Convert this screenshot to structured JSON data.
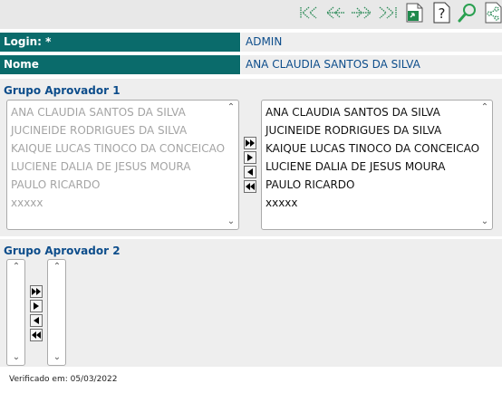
{
  "toolbar": {
    "buttons": [
      {
        "name": "first-record-icon"
      },
      {
        "name": "previous-record-icon"
      },
      {
        "name": "next-record-icon"
      },
      {
        "name": "last-record-icon"
      },
      {
        "name": "export-document-icon"
      },
      {
        "name": "help-icon"
      },
      {
        "name": "search-icon"
      },
      {
        "name": "share-icon"
      }
    ]
  },
  "form": {
    "login_label": "Login: *",
    "login_value": "ADMIN",
    "nome_label": "Nome",
    "nome_value": "ANA CLAUDIA SANTOS DA SILVA"
  },
  "grupo1": {
    "title": "Grupo Aprovador 1",
    "available": [
      "ANA CLAUDIA SANTOS DA SILVA",
      "JUCINEIDE RODRIGUES DA SILVA",
      "KAIQUE LUCAS TINOCO DA CONCEICAO",
      "LUCIENE DALIA DE JESUS MOURA",
      "PAULO RICARDO",
      "xxxxx"
    ],
    "selected": [
      "ANA CLAUDIA SANTOS DA SILVA",
      "JUCINEIDE RODRIGUES DA SILVA",
      "KAIQUE LUCAS TINOCO DA CONCEICAO",
      "LUCIENE DALIA DE JESUS MOURA",
      "PAULO RICARDO",
      "xxxxx"
    ]
  },
  "grupo2": {
    "title": "Grupo Aprovador 2",
    "available": [],
    "selected": []
  },
  "footer": {
    "verified": "Verificado em: 05/03/2022"
  },
  "colors": {
    "label_bg": "#0a6b6b",
    "value_text": "#0d4d8b",
    "section_bg": "#eeeeee",
    "toolbar_bg": "#e8e8e8"
  }
}
